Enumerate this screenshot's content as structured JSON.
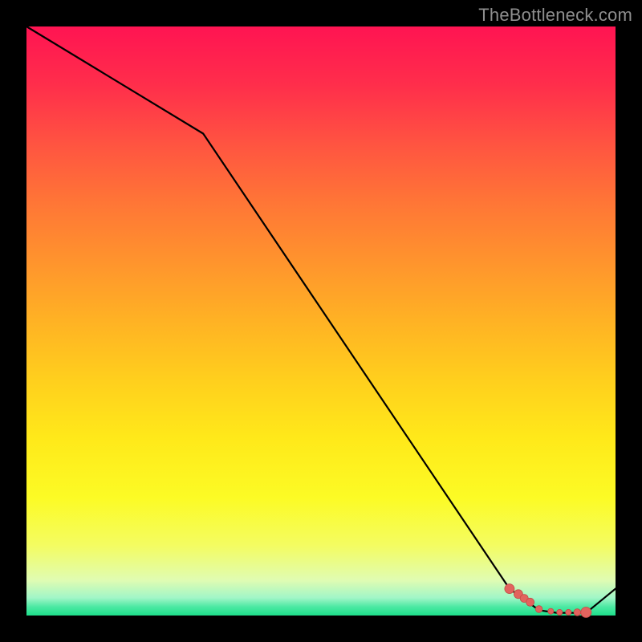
{
  "watermark": "TheBottleneck.com",
  "colors": {
    "line": "#000000",
    "marker_fill": "#e2635e",
    "marker_stroke": "#c24c47",
    "bg_black": "#000000"
  },
  "chart_data": {
    "type": "line",
    "title": "",
    "xlabel": "",
    "ylabel": "",
    "xlim": [
      0,
      100
    ],
    "ylim": [
      0,
      110
    ],
    "grid": false,
    "legend": false,
    "series": [
      {
        "name": "curve",
        "x": [
          0,
          30,
          82,
          87,
          90,
          93,
          95,
          100
        ],
        "values": [
          110,
          90,
          5,
          1,
          0.5,
          0.5,
          0.5,
          5
        ]
      }
    ],
    "markers": {
      "x": [
        82,
        83.5,
        84.5,
        85.5,
        87,
        89,
        90.5,
        92,
        93.5,
        95
      ],
      "values": [
        5,
        4,
        3.2,
        2.5,
        1.2,
        0.8,
        0.6,
        0.6,
        0.6,
        0.6
      ],
      "sizes": [
        6,
        5.5,
        5,
        5,
        4.3,
        3.6,
        3.6,
        3.6,
        4.3,
        6.5
      ]
    }
  }
}
